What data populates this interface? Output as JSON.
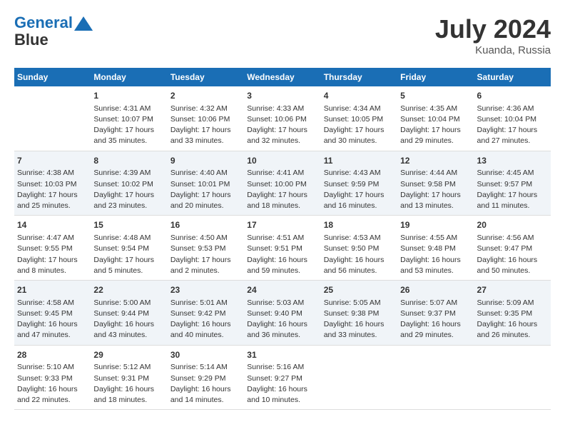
{
  "header": {
    "logo_line1": "General",
    "logo_line2": "Blue",
    "month_title": "July 2024",
    "location": "Kuanda, Russia"
  },
  "days_of_week": [
    "Sunday",
    "Monday",
    "Tuesday",
    "Wednesday",
    "Thursday",
    "Friday",
    "Saturday"
  ],
  "weeks": [
    [
      {
        "day": "",
        "content": ""
      },
      {
        "day": "1",
        "content": "Sunrise: 4:31 AM\nSunset: 10:07 PM\nDaylight: 17 hours\nand 35 minutes."
      },
      {
        "day": "2",
        "content": "Sunrise: 4:32 AM\nSunset: 10:06 PM\nDaylight: 17 hours\nand 33 minutes."
      },
      {
        "day": "3",
        "content": "Sunrise: 4:33 AM\nSunset: 10:06 PM\nDaylight: 17 hours\nand 32 minutes."
      },
      {
        "day": "4",
        "content": "Sunrise: 4:34 AM\nSunset: 10:05 PM\nDaylight: 17 hours\nand 30 minutes."
      },
      {
        "day": "5",
        "content": "Sunrise: 4:35 AM\nSunset: 10:04 PM\nDaylight: 17 hours\nand 29 minutes."
      },
      {
        "day": "6",
        "content": "Sunrise: 4:36 AM\nSunset: 10:04 PM\nDaylight: 17 hours\nand 27 minutes."
      }
    ],
    [
      {
        "day": "7",
        "content": "Sunrise: 4:38 AM\nSunset: 10:03 PM\nDaylight: 17 hours\nand 25 minutes."
      },
      {
        "day": "8",
        "content": "Sunrise: 4:39 AM\nSunset: 10:02 PM\nDaylight: 17 hours\nand 23 minutes."
      },
      {
        "day": "9",
        "content": "Sunrise: 4:40 AM\nSunset: 10:01 PM\nDaylight: 17 hours\nand 20 minutes."
      },
      {
        "day": "10",
        "content": "Sunrise: 4:41 AM\nSunset: 10:00 PM\nDaylight: 17 hours\nand 18 minutes."
      },
      {
        "day": "11",
        "content": "Sunrise: 4:43 AM\nSunset: 9:59 PM\nDaylight: 17 hours\nand 16 minutes."
      },
      {
        "day": "12",
        "content": "Sunrise: 4:44 AM\nSunset: 9:58 PM\nDaylight: 17 hours\nand 13 minutes."
      },
      {
        "day": "13",
        "content": "Sunrise: 4:45 AM\nSunset: 9:57 PM\nDaylight: 17 hours\nand 11 minutes."
      }
    ],
    [
      {
        "day": "14",
        "content": "Sunrise: 4:47 AM\nSunset: 9:55 PM\nDaylight: 17 hours\nand 8 minutes."
      },
      {
        "day": "15",
        "content": "Sunrise: 4:48 AM\nSunset: 9:54 PM\nDaylight: 17 hours\nand 5 minutes."
      },
      {
        "day": "16",
        "content": "Sunrise: 4:50 AM\nSunset: 9:53 PM\nDaylight: 17 hours\nand 2 minutes."
      },
      {
        "day": "17",
        "content": "Sunrise: 4:51 AM\nSunset: 9:51 PM\nDaylight: 16 hours\nand 59 minutes."
      },
      {
        "day": "18",
        "content": "Sunrise: 4:53 AM\nSunset: 9:50 PM\nDaylight: 16 hours\nand 56 minutes."
      },
      {
        "day": "19",
        "content": "Sunrise: 4:55 AM\nSunset: 9:48 PM\nDaylight: 16 hours\nand 53 minutes."
      },
      {
        "day": "20",
        "content": "Sunrise: 4:56 AM\nSunset: 9:47 PM\nDaylight: 16 hours\nand 50 minutes."
      }
    ],
    [
      {
        "day": "21",
        "content": "Sunrise: 4:58 AM\nSunset: 9:45 PM\nDaylight: 16 hours\nand 47 minutes."
      },
      {
        "day": "22",
        "content": "Sunrise: 5:00 AM\nSunset: 9:44 PM\nDaylight: 16 hours\nand 43 minutes."
      },
      {
        "day": "23",
        "content": "Sunrise: 5:01 AM\nSunset: 9:42 PM\nDaylight: 16 hours\nand 40 minutes."
      },
      {
        "day": "24",
        "content": "Sunrise: 5:03 AM\nSunset: 9:40 PM\nDaylight: 16 hours\nand 36 minutes."
      },
      {
        "day": "25",
        "content": "Sunrise: 5:05 AM\nSunset: 9:38 PM\nDaylight: 16 hours\nand 33 minutes."
      },
      {
        "day": "26",
        "content": "Sunrise: 5:07 AM\nSunset: 9:37 PM\nDaylight: 16 hours\nand 29 minutes."
      },
      {
        "day": "27",
        "content": "Sunrise: 5:09 AM\nSunset: 9:35 PM\nDaylight: 16 hours\nand 26 minutes."
      }
    ],
    [
      {
        "day": "28",
        "content": "Sunrise: 5:10 AM\nSunset: 9:33 PM\nDaylight: 16 hours\nand 22 minutes."
      },
      {
        "day": "29",
        "content": "Sunrise: 5:12 AM\nSunset: 9:31 PM\nDaylight: 16 hours\nand 18 minutes."
      },
      {
        "day": "30",
        "content": "Sunrise: 5:14 AM\nSunset: 9:29 PM\nDaylight: 16 hours\nand 14 minutes."
      },
      {
        "day": "31",
        "content": "Sunrise: 5:16 AM\nSunset: 9:27 PM\nDaylight: 16 hours\nand 10 minutes."
      },
      {
        "day": "",
        "content": ""
      },
      {
        "day": "",
        "content": ""
      },
      {
        "day": "",
        "content": ""
      }
    ]
  ]
}
